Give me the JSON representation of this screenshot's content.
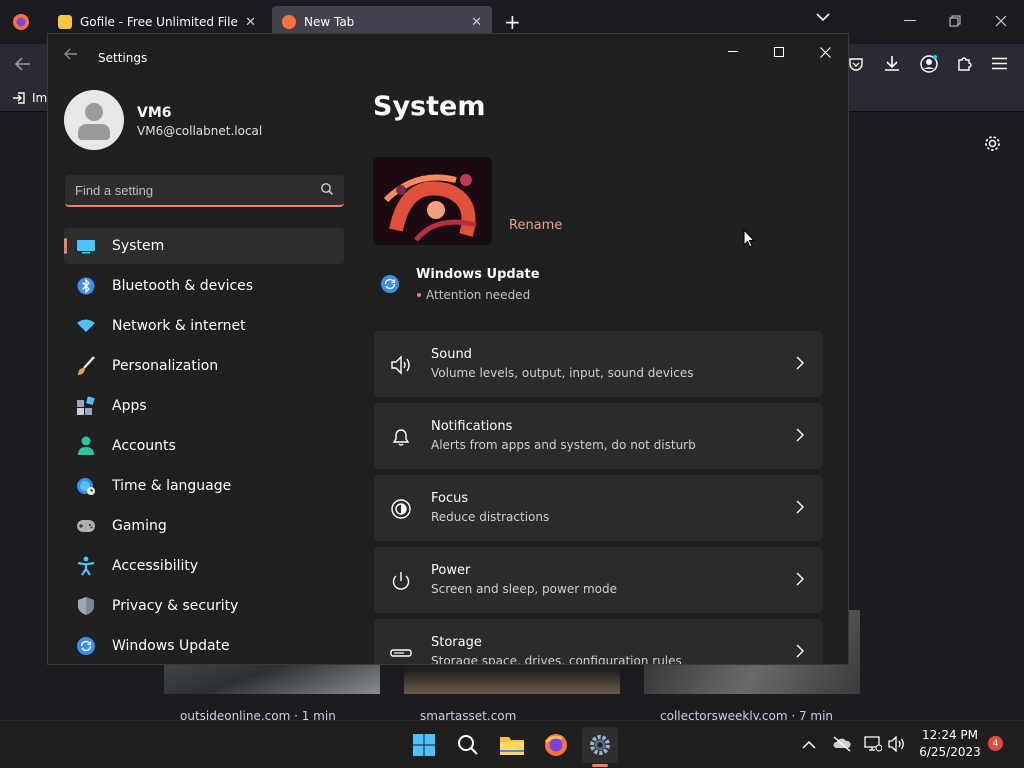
{
  "firefox": {
    "tabs": [
      {
        "title": "Gofile - Free Unlimited File Sha",
        "close": "✕"
      },
      {
        "title": "New Tab",
        "close": "✕"
      }
    ],
    "new_tab": "+",
    "bookmark_label": "Imp",
    "cards": [
      {
        "source": "outsideonline.com · 1 min"
      },
      {
        "source": "smartasset.com"
      },
      {
        "source": "collectorsweekly.com · 7 min"
      }
    ]
  },
  "settings": {
    "window_title": "Settings",
    "user": {
      "name": "VM6",
      "email": "VM6@collabnet.local"
    },
    "search": {
      "placeholder": "Find a setting"
    },
    "nav": [
      {
        "label": "System",
        "icon": "monitor-icon",
        "color": "#4cc2ff"
      },
      {
        "label": "Bluetooth & devices",
        "icon": "bluetooth-icon",
        "color": "#3b8eea"
      },
      {
        "label": "Network & internet",
        "icon": "wifi-icon",
        "color": "#4cc2ff"
      },
      {
        "label": "Personalization",
        "icon": "brush-icon",
        "color": "#e0a060"
      },
      {
        "label": "Apps",
        "icon": "apps-icon",
        "color": "#9aa7b8"
      },
      {
        "label": "Accounts",
        "icon": "person-icon",
        "color": "#2ec4a0"
      },
      {
        "label": "Time & language",
        "icon": "globe-clock-icon",
        "color": "#4cc2ff"
      },
      {
        "label": "Gaming",
        "icon": "gamepad-icon",
        "color": "#b0b0b0"
      },
      {
        "label": "Accessibility",
        "icon": "accessibility-icon",
        "color": "#4cc2ff"
      },
      {
        "label": "Privacy & security",
        "icon": "shield-icon",
        "color": "#a0a8b4"
      },
      {
        "label": "Windows Update",
        "icon": "update-icon",
        "color": "#4cc2ff"
      }
    ],
    "main": {
      "title": "System",
      "rename": "Rename",
      "windows_update": {
        "title": "Windows Update",
        "status": "Attention needed"
      },
      "rows": [
        {
          "title": "Sound",
          "subtitle": "Volume levels, output, input, sound devices",
          "icon": "speaker-icon"
        },
        {
          "title": "Notifications",
          "subtitle": "Alerts from apps and system, do not disturb",
          "icon": "bell-icon"
        },
        {
          "title": "Focus",
          "subtitle": "Reduce distractions",
          "icon": "focus-icon"
        },
        {
          "title": "Power",
          "subtitle": "Screen and sleep, power mode",
          "icon": "power-icon"
        },
        {
          "title": "Storage",
          "subtitle": "Storage space, drives, configuration rules",
          "icon": "storage-icon"
        }
      ]
    },
    "accent": "#e8826a"
  },
  "taskbar": {
    "time": "12:24 PM",
    "date": "6/25/2023",
    "notification_count": "4"
  }
}
